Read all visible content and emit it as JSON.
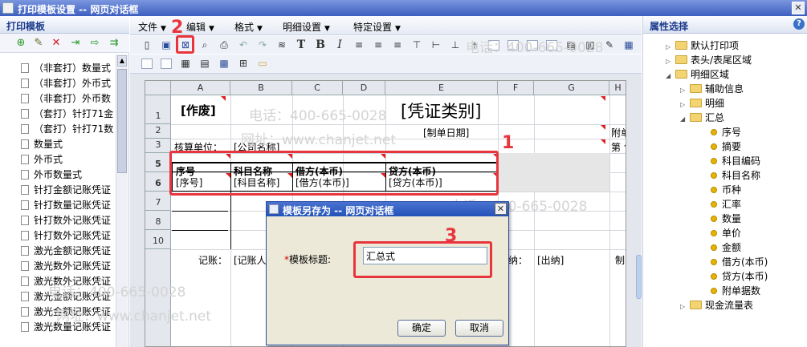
{
  "window": {
    "title": "打印模板设置 -- 网页对话框",
    "close": "✕"
  },
  "left_panel": {
    "title": "打印模板",
    "items": [
      "（非套打）数量式",
      "（非套打）外币式",
      "（非套打）外币数",
      "（套打）针打71金",
      "（套打）针打71数",
      "数量式",
      "外币式",
      "外币数量式",
      "针打金额记账凭证",
      "针打数量记账凭证",
      "针打数外记账凭证",
      "针打数外记账凭证",
      "激光金额记账凭证",
      "激光数外记账凭证",
      "激光数外记账凭证",
      "激光金额记账凭证",
      "激光金额记账凭证",
      "激光数量记账凭证"
    ]
  },
  "menu": {
    "items": [
      "文件",
      "编辑",
      "格式",
      "明细设置",
      "特定设置"
    ]
  },
  "sheet": {
    "columns": [
      "A",
      "B",
      "C",
      "D",
      "E",
      "F",
      "G",
      "H"
    ],
    "rows": [
      "1",
      "2",
      "3",
      "5",
      "6",
      "7",
      "8",
      "10"
    ],
    "cells": {
      "void": "[作废]",
      "voucher_type": "[凭证类别]",
      "make_date": "[制单日期]",
      "attach": "附单",
      "check_unit": "核算单位：",
      "company": "[公司名称]",
      "page": "第 包",
      "seq_h": "序号",
      "acct_h": "科目名称",
      "debit_h": "借方(本币)",
      "credit_h": "贷方(本币)",
      "seq_v": "[序号]",
      "acct_v": "[科目名称]",
      "debit_v": "[借方(本币)]",
      "credit_v": "[贷方(本币)]",
      "bookkeep": "记账：",
      "bookkeeper": "[记账人",
      "cashier_l": "纳：",
      "cashier": "[出纳]",
      "trail": "制"
    }
  },
  "watermark": {
    "phone": "电话：400-665-0028",
    "site": "网址：www.chanjet.net"
  },
  "right_panel": {
    "title": "属性选择",
    "help": "?",
    "tree": {
      "default_print": "默认打印项",
      "header_footer": "表头/表尾区域",
      "detail_area": "明细区域",
      "aux_info": "辅助信息",
      "detail": "明细",
      "summary": "汇总",
      "fields": [
        "序号",
        "摘要",
        "科目编码",
        "科目名称",
        "币种",
        "汇率",
        "数量",
        "单价",
        "金额",
        "借方(本币)",
        "贷方(本币)",
        "附单据数"
      ],
      "cash_flow": "现金流量表"
    }
  },
  "dialog": {
    "title": "模板另存为 -- 网页对话框",
    "close": "✕",
    "label": "模板标题:",
    "required_mark": "*",
    "input_value": "汇总式",
    "ok": "确定",
    "cancel": "取消"
  },
  "annotations": {
    "one": "1",
    "two": "2",
    "three": "3"
  },
  "colors": {
    "accent_red": "#e8353d",
    "title_blue": "#3d5fc0",
    "panel_title": "#1b3a8c"
  }
}
